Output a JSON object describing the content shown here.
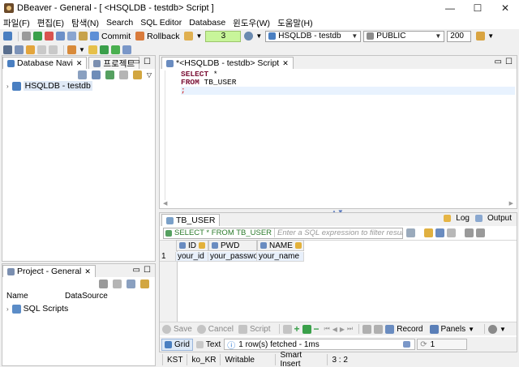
{
  "window": {
    "title": "DBeaver - General - [ <HSQLDB - testdb> Script ]",
    "controls": [
      "—",
      "☐",
      "✕"
    ]
  },
  "menu": [
    "파일(F)",
    "편집(E)",
    "탐색(N)",
    "Search",
    "SQL Editor",
    "Database",
    "윈도우(W)",
    "도움말(H)"
  ],
  "toolbar": {
    "commit_label": "Commit",
    "rollback_label": "Rollback",
    "tx_counter": "3",
    "connection": "HSQLDB - testdb",
    "schema": "PUBLIC",
    "limit": "200"
  },
  "navigator": {
    "tab_label": "Database Navi",
    "tab2_label": "프로젝트",
    "tree": [
      {
        "label": "HSQLDB - testdb"
      }
    ]
  },
  "project": {
    "tab_label": "Project - General",
    "columns": [
      "Name",
      "DataSource"
    ],
    "items": [
      {
        "label": "SQL Scripts"
      }
    ]
  },
  "editor": {
    "tab_label": "*<HSQLDB - testdb> Script",
    "lines": [
      {
        "kw": "SELECT",
        "rest": " *"
      },
      {
        "kw": "  FROM",
        "rest": " TB_USER"
      },
      {
        "kw": "",
        "rest": ";"
      }
    ]
  },
  "results": {
    "tab_label": "TB_USER",
    "log_label": "Log",
    "output_label": "Output",
    "query_label": "SELECT * FROM TB_USER",
    "filter_placeholder": "Enter a SQL expression to filter results (use Ctrl+Spa",
    "columns": [
      "ID",
      "PWD",
      "NAME"
    ],
    "rows": [
      {
        "num": "1",
        "cells": [
          "your_id",
          "your_password",
          "your_name"
        ]
      }
    ],
    "actions": {
      "save": "Save",
      "cancel": "Cancel",
      "script": "Script",
      "record": "Record",
      "panels": "Panels"
    },
    "view_tabs": {
      "grid": "Grid",
      "text": "Text"
    },
    "fetch_status": "1 row(s) fetched - 1ms",
    "row_counter": "1"
  },
  "statusbar": {
    "timezone": "KST",
    "locale": "ko_KR",
    "mode": "Writable",
    "insert": "Smart Insert",
    "position": "3 : 2"
  },
  "colors": {
    "keyword": "#7a0f34",
    "accent_blue": "#1e6fcf",
    "grid_header": "#f1f1f1",
    "selected_line": "#e8f2fe"
  }
}
